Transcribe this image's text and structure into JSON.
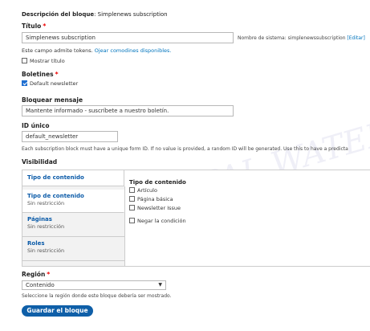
{
  "block_description": {
    "label": "Descripción del bloque",
    "value": "Simplenews subscription"
  },
  "title": {
    "label": "Título",
    "value": "Simplenews subscription",
    "machine_name_label": "Nombre de sistema: simplenewssubscription",
    "edit_link": "[Editar]",
    "tokens_text": "Este campo admite tokens.",
    "tokens_link": "Ojear comodines disponibles.",
    "show_title_label": "Mostrar título"
  },
  "newsletters": {
    "label": "Boletines",
    "option": "Default newsletter",
    "checked": true
  },
  "block_message": {
    "label": "Bloquear mensaje",
    "value": "Mantente informado  - suscríbete a nuestro boletín."
  },
  "unique_id": {
    "label": "ID único",
    "value": "default_newsletter",
    "description": "Each subscription block must have a unique form ID. If no value is provided, a random ID will be generated. Use this to have a predicta"
  },
  "visibility": {
    "label": "Visibilidad",
    "tabs": [
      {
        "title": "Tipo de contenido",
        "summary": "Sin restricción"
      },
      {
        "title": "Páginas",
        "summary": "Sin restricción"
      },
      {
        "title": "Roles",
        "summary": "Sin restricción"
      }
    ],
    "panel": {
      "heading": "Tipo de contenido",
      "fieldset_label": "Tipo de contenido",
      "options": [
        "Artículo",
        "Página básica",
        "Newsletter Issue"
      ],
      "negate_label": "Negar la condición"
    }
  },
  "region": {
    "label": "Región",
    "selected": "Contenido",
    "description": "Seleccione la región donde este bloque debería ser mostrado."
  },
  "save_button": "Guardar el bloque",
  "watermark": "DRUPAL WATERMARK"
}
